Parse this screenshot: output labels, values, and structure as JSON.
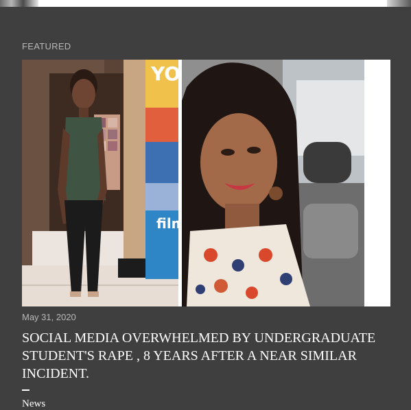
{
  "section": {
    "label": "FEATURED"
  },
  "post": {
    "date": "May 31, 2020",
    "title": "SOCIAL MEDIA OVERWHELMED BY UNDERGRADUATE STUDENT'S RAPE , 8 YEARS AFTER A NEAR SIMILAR INCIDENT.",
    "label": "News",
    "image_banner_text": "film"
  },
  "colors": {
    "background": "#3f3f3f",
    "text_primary": "#ffffff",
    "text_muted": "#b9b9b9"
  }
}
